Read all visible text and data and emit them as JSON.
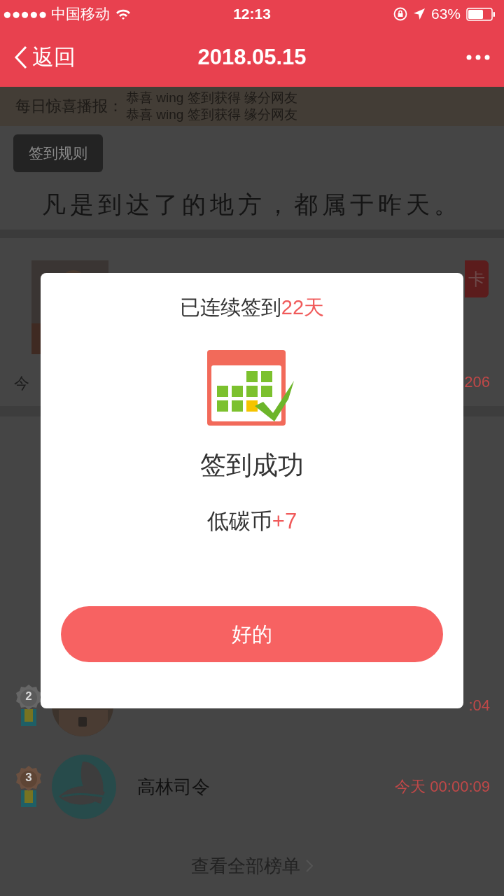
{
  "status_bar": {
    "carrier": "●●●●● 中国移动",
    "time": "12:13",
    "battery": "63%"
  },
  "nav": {
    "back": "返回",
    "title": "2018.05.15"
  },
  "announcement": {
    "label": "每日惊喜播报：",
    "messages": [
      "恭喜 wing 签到获得 缘分网友",
      "恭喜 wing 签到获得 缘分网友"
    ]
  },
  "rules_button": "签到规则",
  "quote": "凡是到达了的地方，都属于昨天。",
  "profile_card": {
    "action": "卡",
    "stat_label": "今",
    "stat_value": "206"
  },
  "ranking": [
    {
      "rank": "2",
      "time": ":04"
    },
    {
      "rank": "3",
      "kind": "logo",
      "name": "高林司令",
      "time": "今天 00:00:09"
    }
  ],
  "view_all": "查看全部榜单",
  "dialog": {
    "streak_text": "已连续签到",
    "streak_days": "22天",
    "title": "签到成功",
    "reward_label": "低碳币",
    "reward_value": "+7",
    "button": "好的"
  }
}
